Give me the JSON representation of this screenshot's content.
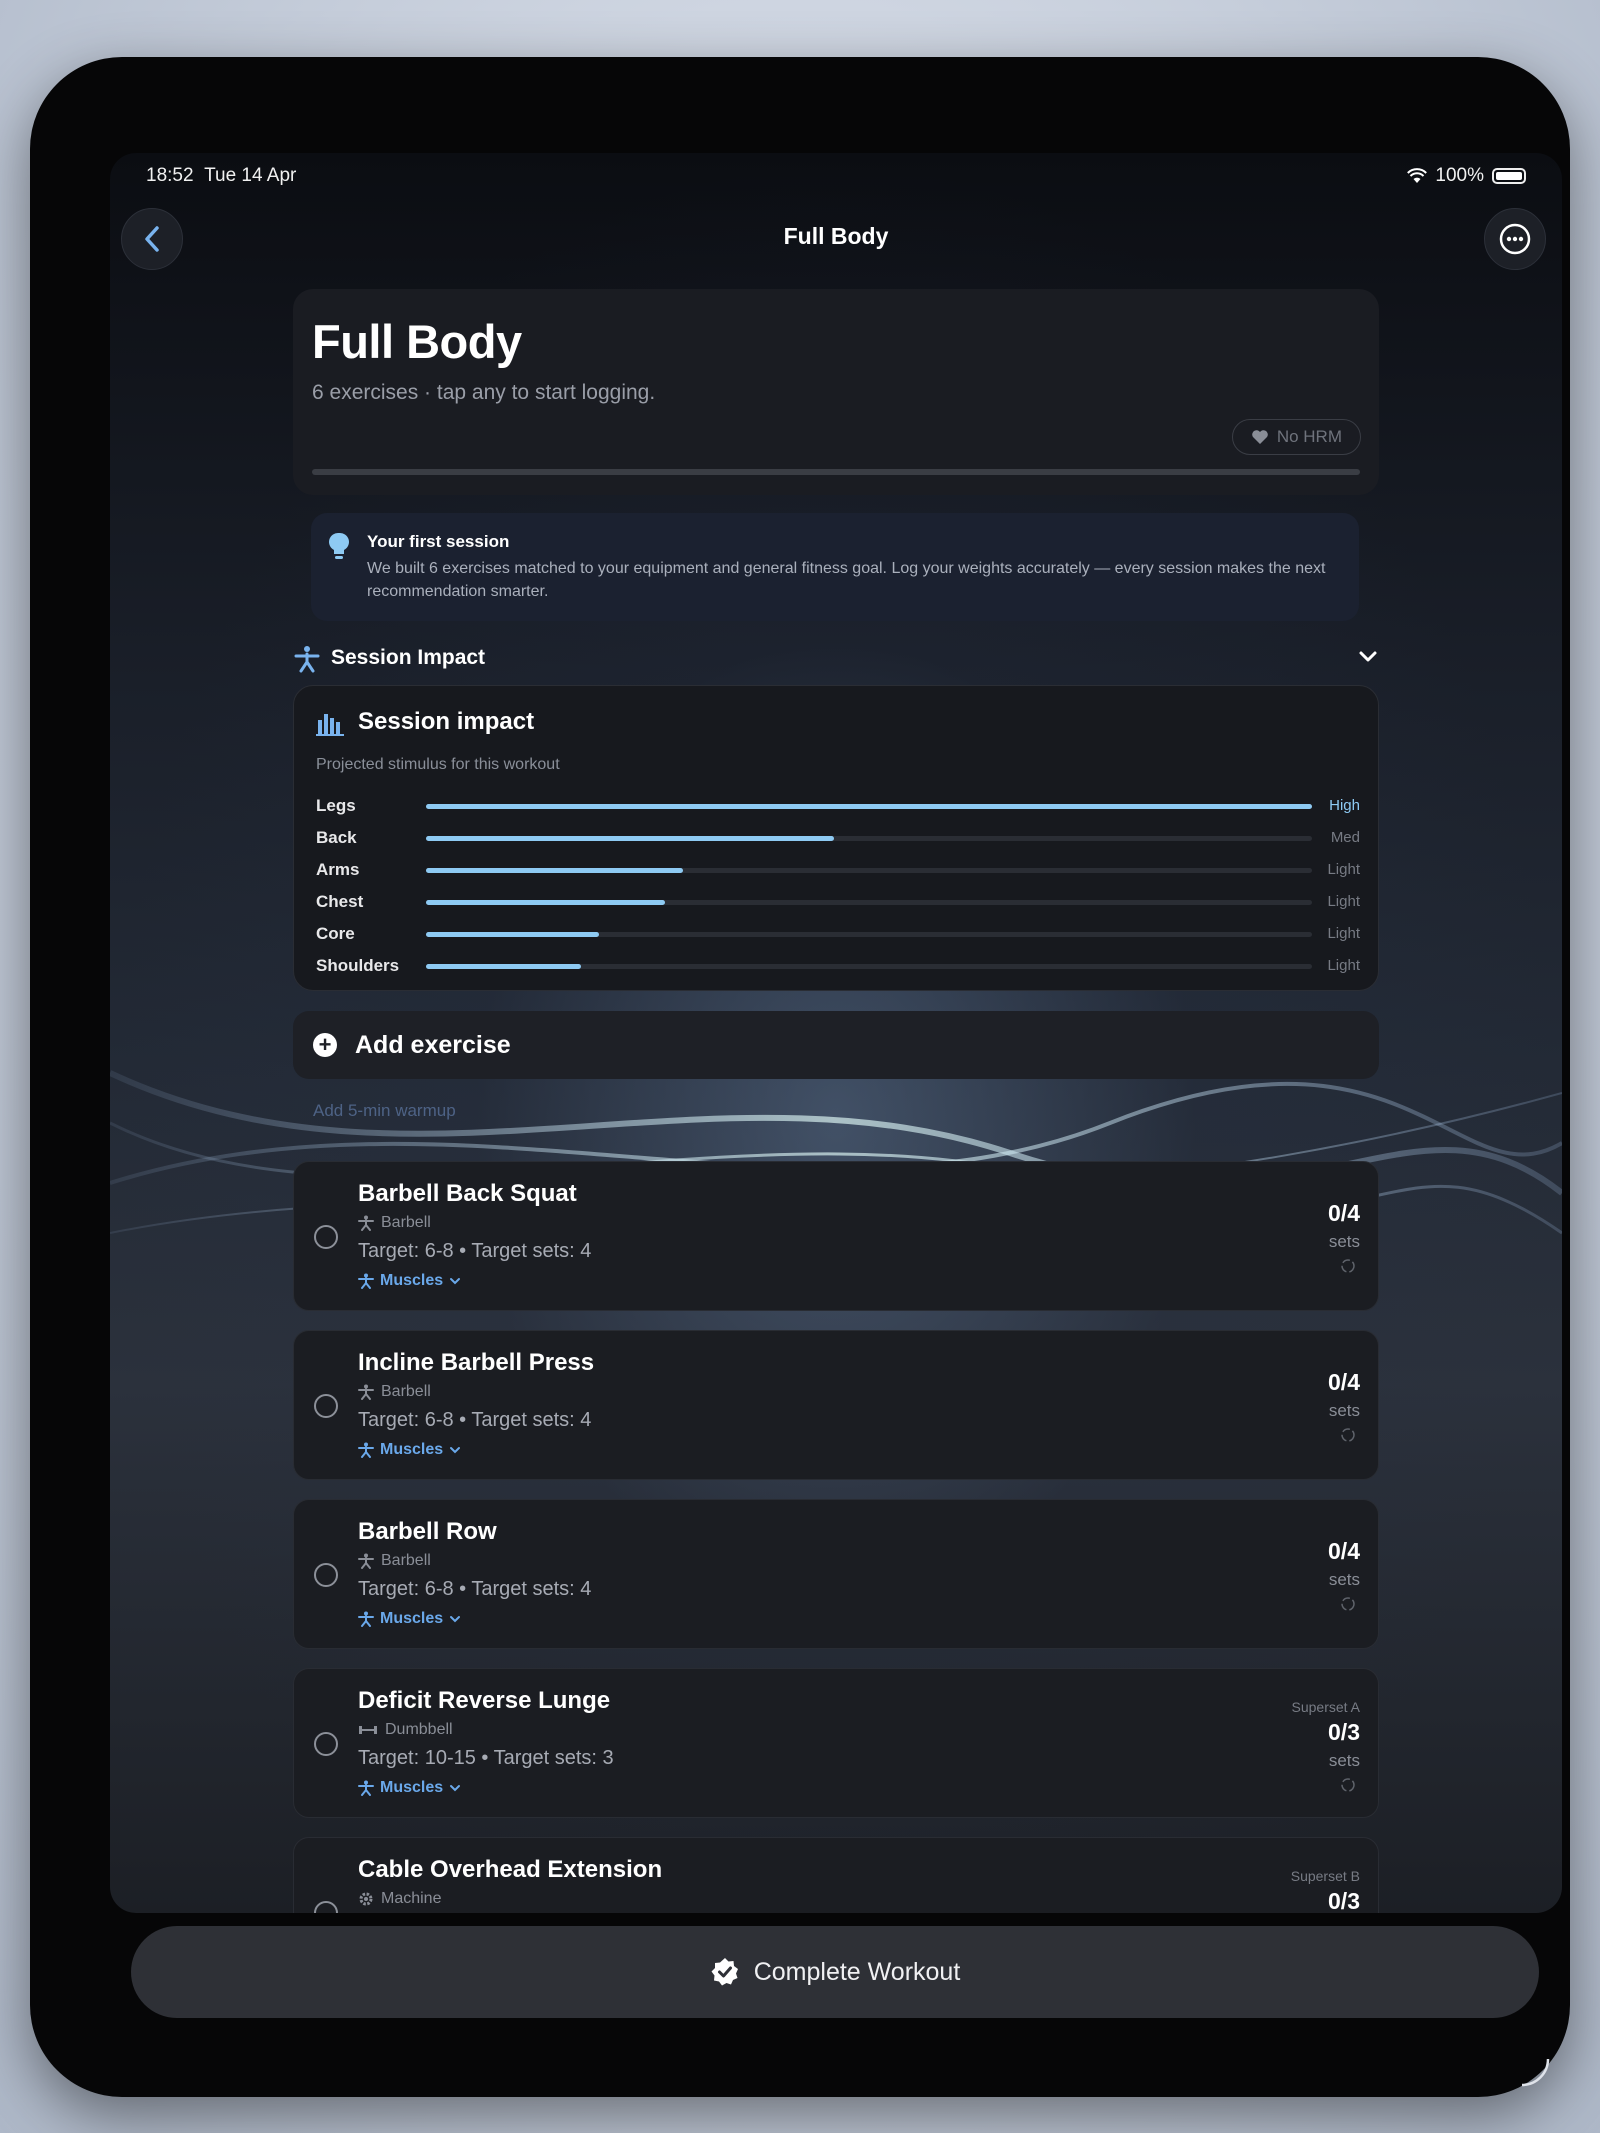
{
  "status": {
    "time": "18:52",
    "date": "Tue 14 Apr",
    "battery": "100%"
  },
  "nav": {
    "title": "Full Body"
  },
  "hero": {
    "title": "Full Body",
    "subtitle": "6 exercises · tap any to start logging.",
    "hrm_label": "No HRM"
  },
  "tip": {
    "title": "Your first session",
    "body": "We built 6 exercises matched to your equipment and general fitness goal. Log your weights accurately — every session makes the next recommendation smarter."
  },
  "section": {
    "label": "Session Impact"
  },
  "impact": {
    "title": "Session impact",
    "subtitle": "Projected stimulus for this workout",
    "rows": [
      {
        "muscle": "Legs",
        "level": "High",
        "value": 1.0
      },
      {
        "muscle": "Back",
        "level": "Med",
        "value": 0.46
      },
      {
        "muscle": "Arms",
        "level": "Light",
        "value": 0.29
      },
      {
        "muscle": "Chest",
        "level": "Light",
        "value": 0.27
      },
      {
        "muscle": "Core",
        "level": "Light",
        "value": 0.195
      },
      {
        "muscle": "Shoulders",
        "level": "Light",
        "value": 0.175
      }
    ]
  },
  "add_exercise": {
    "label": "Add exercise"
  },
  "warmup": {
    "label": "Add 5-min warmup"
  },
  "exercises": [
    {
      "name": "Barbell Back Squat",
      "equipment": "Barbell",
      "target": "Target: 6-8 • Target sets: 4",
      "muscles_label": "Muscles",
      "count": "0/4",
      "sets_label": "sets",
      "superset": ""
    },
    {
      "name": "Incline Barbell Press",
      "equipment": "Barbell",
      "target": "Target: 6-8 • Target sets: 4",
      "muscles_label": "Muscles",
      "count": "0/4",
      "sets_label": "sets",
      "superset": ""
    },
    {
      "name": "Barbell Row",
      "equipment": "Barbell",
      "target": "Target: 6-8 • Target sets: 4",
      "muscles_label": "Muscles",
      "count": "0/4",
      "sets_label": "sets",
      "superset": ""
    },
    {
      "name": "Deficit Reverse Lunge",
      "equipment": "Dumbbell",
      "target": "Target: 10-15 • Target sets: 3",
      "muscles_label": "Muscles",
      "count": "0/3",
      "sets_label": "sets",
      "superset": "Superset A"
    },
    {
      "name": "Cable Overhead Extension",
      "equipment": "Machine",
      "target": "",
      "muscles_label": "",
      "count": "0/3",
      "sets_label": "",
      "superset": "Superset B"
    }
  ],
  "complete": {
    "label": "Complete Workout"
  },
  "colors": {
    "accent": "#8ecaf3",
    "link": "#6aa8ea",
    "card": "#1b1d22",
    "background": "#0b0d12"
  }
}
